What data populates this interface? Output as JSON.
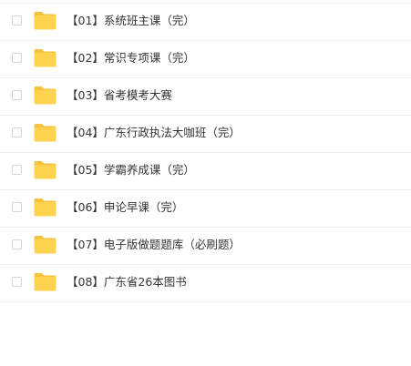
{
  "files": [
    {
      "name": "【01】系统班主课（完）",
      "icon": "folder-icon",
      "checked": false
    },
    {
      "name": "【02】常识专项课（完）",
      "icon": "folder-icon",
      "checked": false
    },
    {
      "name": "【03】省考模考大赛",
      "icon": "folder-icon",
      "checked": false
    },
    {
      "name": "【04】广东行政执法大咖班（完）",
      "icon": "folder-icon",
      "checked": false
    },
    {
      "name": "【05】学霸养成课（完）",
      "icon": "folder-icon",
      "checked": false
    },
    {
      "name": "【06】申论早课（完）",
      "icon": "folder-icon",
      "checked": false
    },
    {
      "name": "【07】电子版做题题库（必刷题）",
      "icon": "folder-icon",
      "checked": false
    },
    {
      "name": "【08】广东省26本图书",
      "icon": "folder-icon",
      "checked": false
    }
  ],
  "colors": {
    "folder_body": "#ffd34e",
    "folder_tab": "#f7c23c",
    "divider": "#f0f0f0",
    "checkbox_border": "#d5d5d5",
    "text": "#333333"
  }
}
